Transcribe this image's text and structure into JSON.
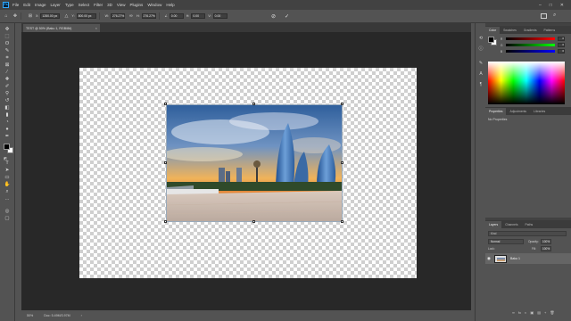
{
  "app": {
    "logo_text": "Ps",
    "menu": [
      "File",
      "Edit",
      "Image",
      "Layer",
      "Type",
      "Select",
      "Filter",
      "3D",
      "View",
      "Plugins",
      "Window",
      "Help"
    ],
    "window_controls": [
      "–",
      "□",
      "✕"
    ]
  },
  "options": {
    "x_label": "X:",
    "x_value": "1280.00 px",
    "y_label": "Y:",
    "y_value": "800.00 px",
    "w_label": "W:",
    "w_value": "276.27%",
    "h_label": "H:",
    "h_value": "276.27%",
    "angle_label": "∠",
    "angle_value": "0.00",
    "hskew_label": "H:",
    "hskew_value": "0.00",
    "vskew_label": "V:",
    "vskew_value": "0.00",
    "cancel_glyph": "⊘",
    "commit_glyph": "✓"
  },
  "document": {
    "tab_title": "TEST @ 50% (Baku 1, RGB/8#)",
    "close_glyph": "×"
  },
  "status": {
    "zoom": "50%",
    "doc_info": "Doc: 5.49M/3.97M"
  },
  "panels": {
    "color_tabs": [
      "Color",
      "Swatches",
      "Gradients",
      "Patterns"
    ],
    "sliders": [
      {
        "label": "R",
        "value": "0"
      },
      {
        "label": "G",
        "value": "0"
      },
      {
        "label": "B",
        "value": "0"
      }
    ],
    "props_tabs": [
      "Properties",
      "Adjustments",
      "Libraries"
    ],
    "no_properties": "No Properties",
    "layers_tabs": [
      "Layers",
      "Channels",
      "Paths"
    ],
    "layer_filter": "Kind",
    "blend_mode": "Normal",
    "opacity_label": "Opacity:",
    "opacity_value": "100%",
    "lock_label": "Lock:",
    "fill_label": "Fill:",
    "fill_value": "100%",
    "layer_name": "Baku 1",
    "layer_footer_icons": [
      "∞",
      "fx",
      "◐",
      "▣",
      "▤",
      "+",
      "🗑"
    ]
  },
  "colors": {
    "foreground": "#000000",
    "background": "#ffffff",
    "accent": "#31a8ff"
  }
}
